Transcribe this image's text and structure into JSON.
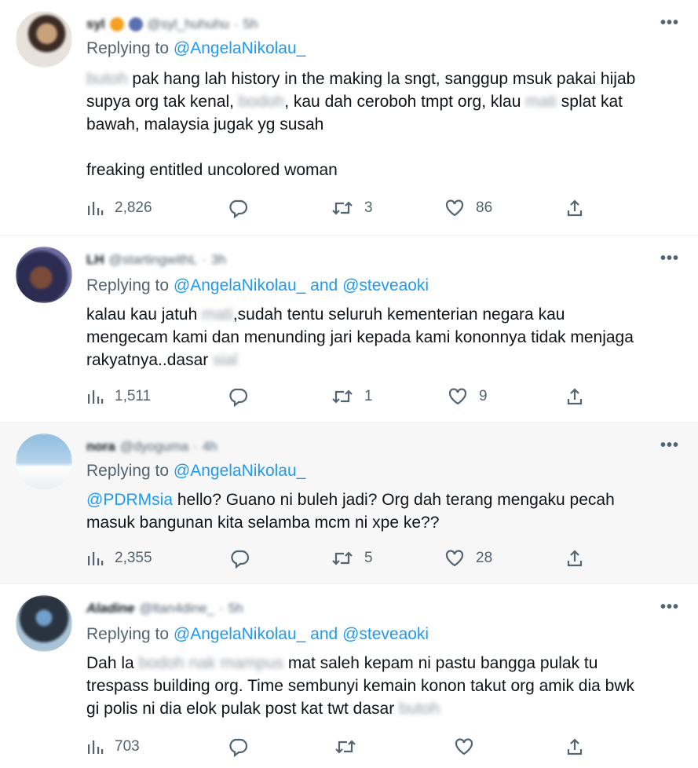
{
  "tweets": [
    {
      "name": "syl",
      "handle": "@syl_huhuhu",
      "time": "5h",
      "replying_label": "Replying to",
      "replying_mentions": "@AngelaNikolau_",
      "replying_and": "",
      "replying_second": "",
      "text_lines": [
        "pak hang lah history in the making la sngt, sanggup msuk pakai hijab",
        "supya org tak kenal,",
        "kau dah ceroboh tmpt org, klau",
        "splat kat",
        "bawah, malaysia jugak yg susah",
        "freaking entitled uncolored woman"
      ],
      "censored": [
        "butoh",
        "bodoh",
        "mati"
      ],
      "views": "2,826",
      "retweets": "3",
      "likes": "86"
    },
    {
      "name": "LH",
      "handle": "@startingwithL",
      "time": "3h",
      "replying_label": "Replying to",
      "replying_mentions": "@AngelaNikolau_",
      "replying_and": "and",
      "replying_second": "@steveaoki",
      "text_lines": [
        "kalau kau jatuh",
        ",sudah tentu seluruh kementerian negara kau",
        "mengecam kami dan menunding jari kepada kami kononnya tidak menjaga",
        "rakyatnya..dasar"
      ],
      "censored": [
        "mati",
        "sial"
      ],
      "views": "1,511",
      "retweets": "1",
      "likes": "9"
    },
    {
      "name": "nora",
      "handle": "@dyoguma",
      "time": "4h",
      "replying_label": "Replying to",
      "replying_mentions": "@AngelaNikolau_",
      "replying_and": "",
      "replying_second": "",
      "text_mention": "@PDRMsia",
      "text_lines": [
        "hello? Guano ni buleh jadi? Org dah terang mengaku pecah",
        "masuk bangunan kita selamba mcm ni xpe ke??"
      ],
      "censored": [],
      "views": "2,355",
      "retweets": "5",
      "likes": "28"
    },
    {
      "name": "Aladine",
      "handle": "@ltan4dine_",
      "time": "5h",
      "replying_label": "Replying to",
      "replying_mentions": "@AngelaNikolau_",
      "replying_and": "and",
      "replying_second": "@steveaoki",
      "text_lines": [
        "Dah la",
        "mat saleh kepam ni pastu bangga pulak tu",
        "trespass building org. Time sembunyi kemain konon takut org amik dia bwk",
        "gi polis ni dia elok pulak post kat twt dasar"
      ],
      "censored": [
        "bodoh nak mampus",
        "butoh"
      ],
      "views": "703",
      "retweets": "",
      "likes": ""
    }
  ],
  "icons": {
    "more": "more-icon",
    "views": "analytics-icon",
    "reply": "reply-icon",
    "retweet": "retweet-icon",
    "like": "heart-icon",
    "share": "share-icon"
  },
  "colors": {
    "link": "#1d9bf0",
    "muted": "#536471",
    "text": "#0f1419",
    "highlight_bg": "#f7f7f7"
  }
}
